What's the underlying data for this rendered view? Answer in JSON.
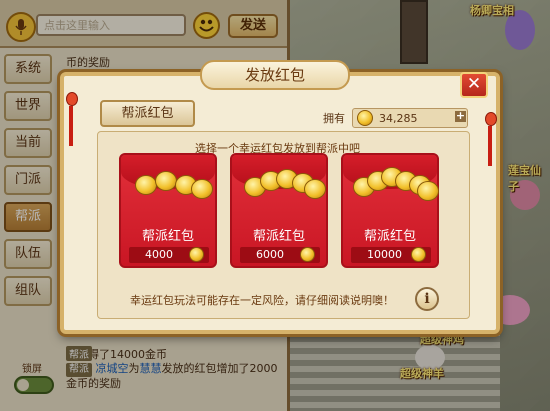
{
  "chat": {
    "input_placeholder": "点击这里输入",
    "send_label": "发送",
    "tabs": [
      "系统",
      "世界",
      "当前",
      "门派",
      "帮派",
      "队伍",
      "组队"
    ],
    "active_tab": "帮派",
    "messages": {
      "line1": "币的奖励",
      "line2_channel": "帮派",
      "line2_text": "，获得了14000金币",
      "line3_channel": "帮派",
      "line3_name1": "凉城空",
      "line3_mid": "为",
      "line3_name2": "慧慧",
      "line3_text": "发放的红包增加了2000",
      "line4": "金币的奖励"
    },
    "lock_label": "锁屏"
  },
  "world": {
    "npc_labels": [
      "杨卿宝相",
      "莲宝仙子",
      "超级神鸡",
      "超级神羊"
    ]
  },
  "dialog": {
    "title": "发放红包",
    "close_label": "✕",
    "tab_label": "帮派红包",
    "owned_label": "拥有",
    "owned_amount": "34,285",
    "plus_label": "+",
    "hint": "选择一个幸运红包发放到帮派中吧",
    "envelopes": [
      {
        "label": "帮派红包",
        "amount": "4000"
      },
      {
        "label": "帮派红包",
        "amount": "6000"
      },
      {
        "label": "帮派红包",
        "amount": "10000"
      }
    ],
    "note": "幸运红包玩法可能存在一定风险，请仔细阅读说明噢！",
    "info_label": "i"
  },
  "colors": {
    "envelope_red": "#d21f2b",
    "gold": "#f2c02a",
    "close_red": "#d23a26"
  }
}
